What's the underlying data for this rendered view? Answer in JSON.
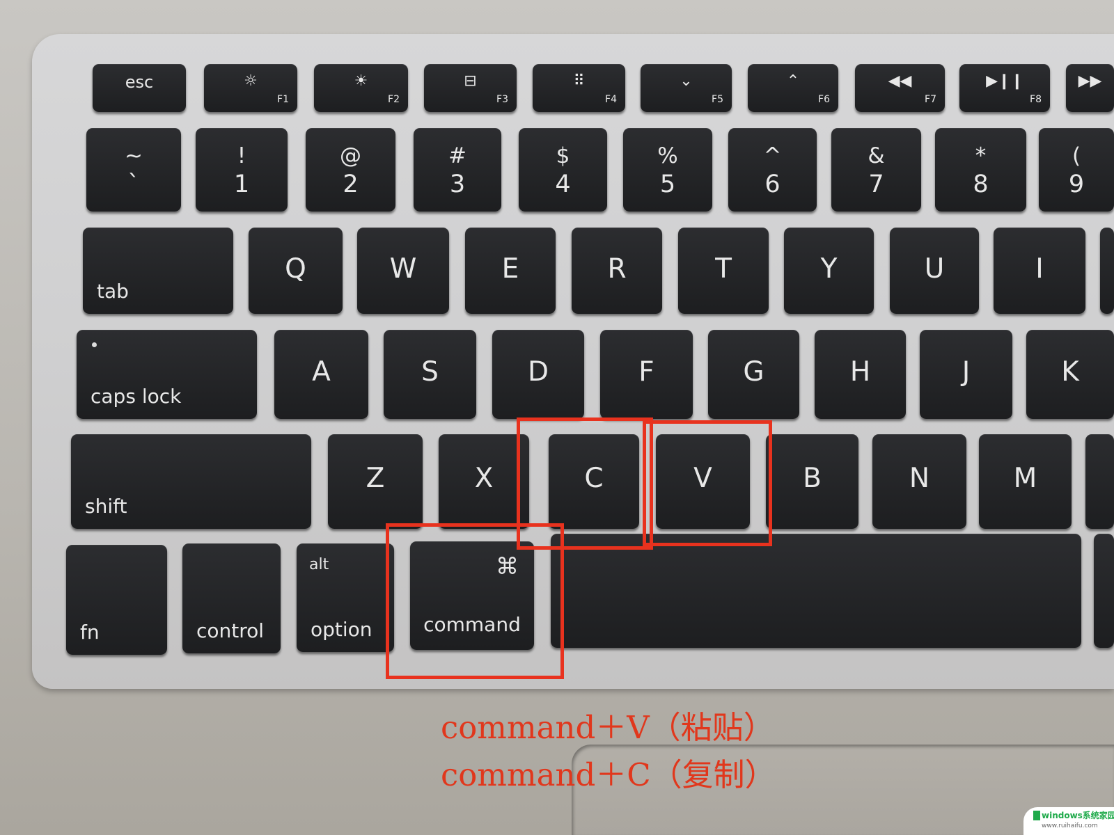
{
  "keyboard": {
    "fn_row": [
      {
        "label": "esc"
      },
      {
        "icon": "brightness-down-icon",
        "glyph": "☼",
        "label": "F1"
      },
      {
        "icon": "brightness-up-icon",
        "glyph": "☀",
        "label": "F2"
      },
      {
        "icon": "mission-control-icon",
        "glyph": "⊟",
        "label": "F3"
      },
      {
        "icon": "launchpad-icon",
        "glyph": "⠿",
        "label": "F4"
      },
      {
        "icon": "keyboard-light-down-icon",
        "glyph": "⌄",
        "label": "F5"
      },
      {
        "icon": "keyboard-light-up-icon",
        "glyph": "⌃",
        "label": "F6"
      },
      {
        "icon": "rewind-icon",
        "glyph": "◀◀",
        "label": "F7"
      },
      {
        "icon": "play-pause-icon",
        "glyph": "▶❙❙",
        "label": "F8"
      },
      {
        "icon": "fast-forward-icon",
        "glyph": "▶▶",
        "label": ""
      }
    ],
    "number_row": [
      {
        "top": "~",
        "bottom": "`"
      },
      {
        "top": "!",
        "bottom": "1"
      },
      {
        "top": "@",
        "bottom": "2"
      },
      {
        "top": "#",
        "bottom": "3"
      },
      {
        "top": "$",
        "bottom": "4"
      },
      {
        "top": "%",
        "bottom": "5"
      },
      {
        "top": "^",
        "bottom": "6"
      },
      {
        "top": "&",
        "bottom": "7"
      },
      {
        "top": "*",
        "bottom": "8"
      },
      {
        "top": "(",
        "bottom": "9"
      }
    ],
    "qwerty_row": [
      "tab",
      "Q",
      "W",
      "E",
      "R",
      "T",
      "Y",
      "U",
      "I",
      ""
    ],
    "home_row": [
      "caps lock",
      "A",
      "S",
      "D",
      "F",
      "G",
      "H",
      "J",
      "K"
    ],
    "shift_row": [
      "shift",
      "Z",
      "X",
      "C",
      "V",
      "B",
      "N",
      "M",
      ""
    ],
    "bottom_row": {
      "fn": "fn",
      "control": "control",
      "alt": "alt",
      "option": "option",
      "command_symbol": "⌘",
      "command": "command"
    }
  },
  "annotations": {
    "color": "#e8321e",
    "line1": "command＋V（粘贴）",
    "line2": "command＋C（复制）"
  },
  "watermark": {
    "text": "windows系统家园",
    "url": "www.ruihaifu.com"
  }
}
